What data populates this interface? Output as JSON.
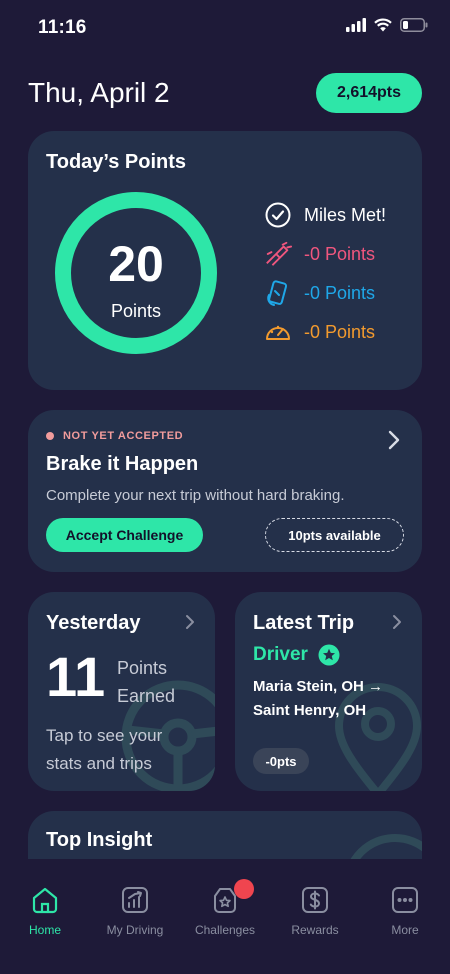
{
  "status_bar": {
    "time": "11:16"
  },
  "header": {
    "date": "Thu, April 2",
    "total_points": "2,614pts"
  },
  "todays_points": {
    "title": "Today’s Points",
    "points_value": "20",
    "points_label": "Points",
    "ring_progress": 1.0,
    "metrics": [
      {
        "icon": "check-circle-icon",
        "label": "Miles Met!",
        "color": "#ffffff"
      },
      {
        "icon": "hard-braking-icon",
        "label": "-0 Points",
        "color": "#f0567e"
      },
      {
        "icon": "phone-use-icon",
        "label": "-0 Points",
        "color": "#1fa7e8"
      },
      {
        "icon": "speedometer-icon",
        "label": "-0 Points",
        "color": "#f29a2e"
      }
    ]
  },
  "challenge": {
    "status": "NOT YET ACCEPTED",
    "title": "Brake it Happen",
    "description": "Complete your next trip without hard braking.",
    "accept_label": "Accept Challenge",
    "available": "10pts available"
  },
  "yesterday": {
    "title": "Yesterday",
    "points": "11",
    "points_label": "Points Earned",
    "tap_text": "Tap to see your stats and trips"
  },
  "latest_trip": {
    "title": "Latest Trip",
    "role": "Driver",
    "route": "Maria Stein, OH → Saint Henry, OH",
    "points": "-0pts"
  },
  "insight": {
    "title": "Top Insight"
  },
  "tabs": [
    {
      "label": "Home",
      "icon": "home-icon",
      "active": true
    },
    {
      "label": "My Driving",
      "icon": "chart-icon",
      "active": false
    },
    {
      "label": "Challenges",
      "icon": "trophy-icon",
      "active": false
    },
    {
      "label": "Rewards",
      "icon": "dollar-icon",
      "active": false
    },
    {
      "label": "More",
      "icon": "more-icon",
      "active": false
    }
  ],
  "colors": {
    "accent": "#2ee6a8",
    "background": "#1e1a38",
    "card": "#24304a"
  }
}
